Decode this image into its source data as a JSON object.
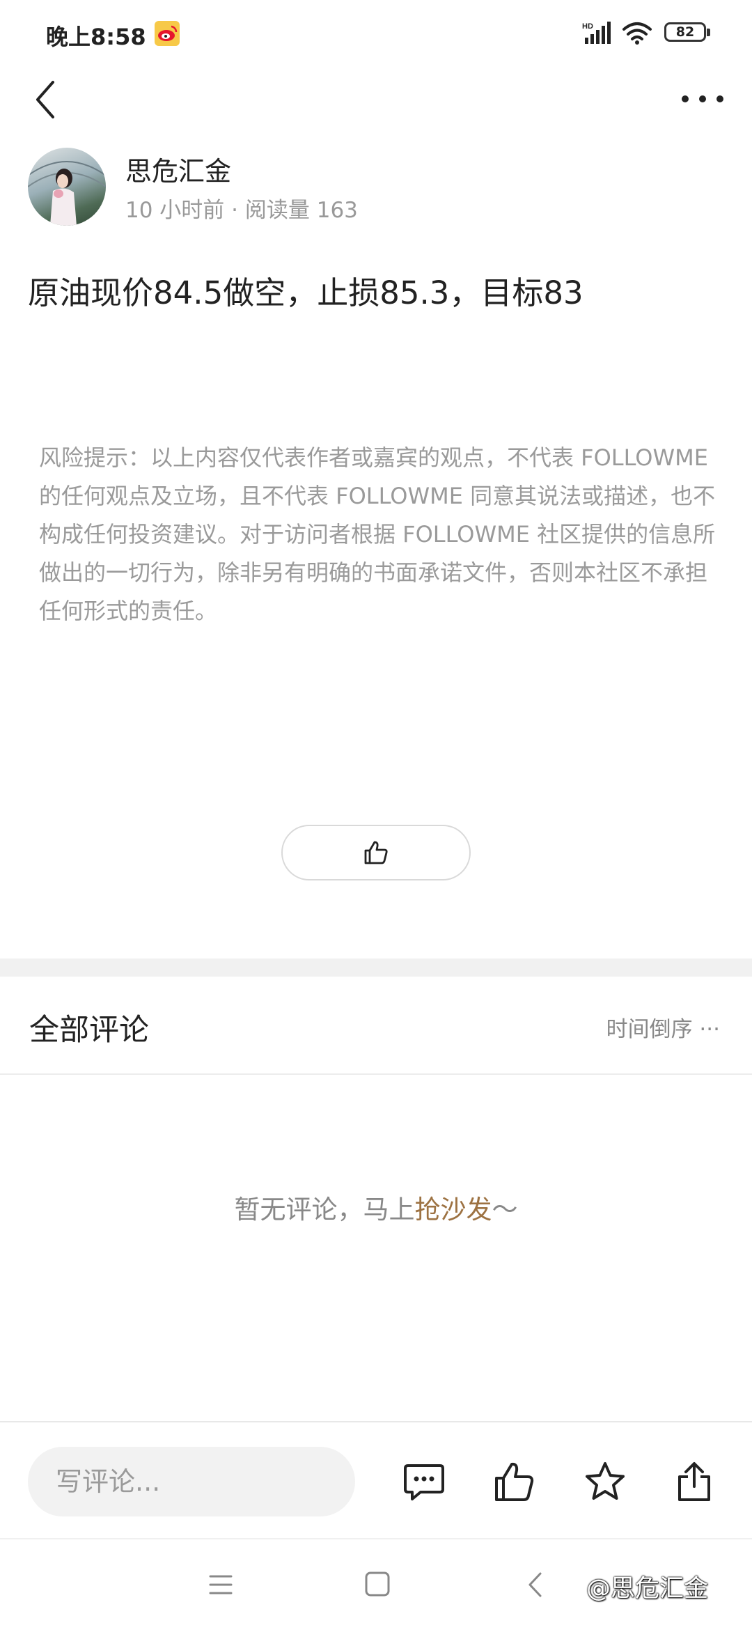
{
  "status_bar": {
    "time": "晚上8:58",
    "battery": "82",
    "signal_badge": "HD"
  },
  "author": {
    "name": "思危汇金",
    "meta": "10 小时前 · 阅读量 163"
  },
  "post": {
    "title": "原油现价84.5做空，止损85.3，目标83",
    "disclaimer": "风险提示：以上内容仅代表作者或嘉宾的观点，不代表 FOLLOWME 的任何观点及立场，且不代表 FOLLOWME 同意其说法或描述，也不构成任何投资建议。对于访问者根据 FOLLOWME 社区提供的信息所做出的一切行为，除非另有明确的书面承诺文件，否则本社区不承担任何形式的责任。"
  },
  "comments": {
    "title": "全部评论",
    "sort_label": "时间倒序 ···",
    "empty_prefix": "暂无评论，马上",
    "empty_link": "抢沙发",
    "empty_suffix": "～"
  },
  "bottom_bar": {
    "input_placeholder": "写评论..."
  },
  "watermark": "@思危汇金",
  "icons": {
    "back": "back-arrow-icon",
    "more": "more-dots-icon",
    "like": "thumbs-up-icon",
    "comments": "comment-bubble-icon",
    "favorite": "star-icon",
    "share": "share-icon"
  },
  "colors": {
    "link": "#9d7242",
    "muted_text": "#9a9a9a",
    "input_bg": "#f2f2f2"
  }
}
